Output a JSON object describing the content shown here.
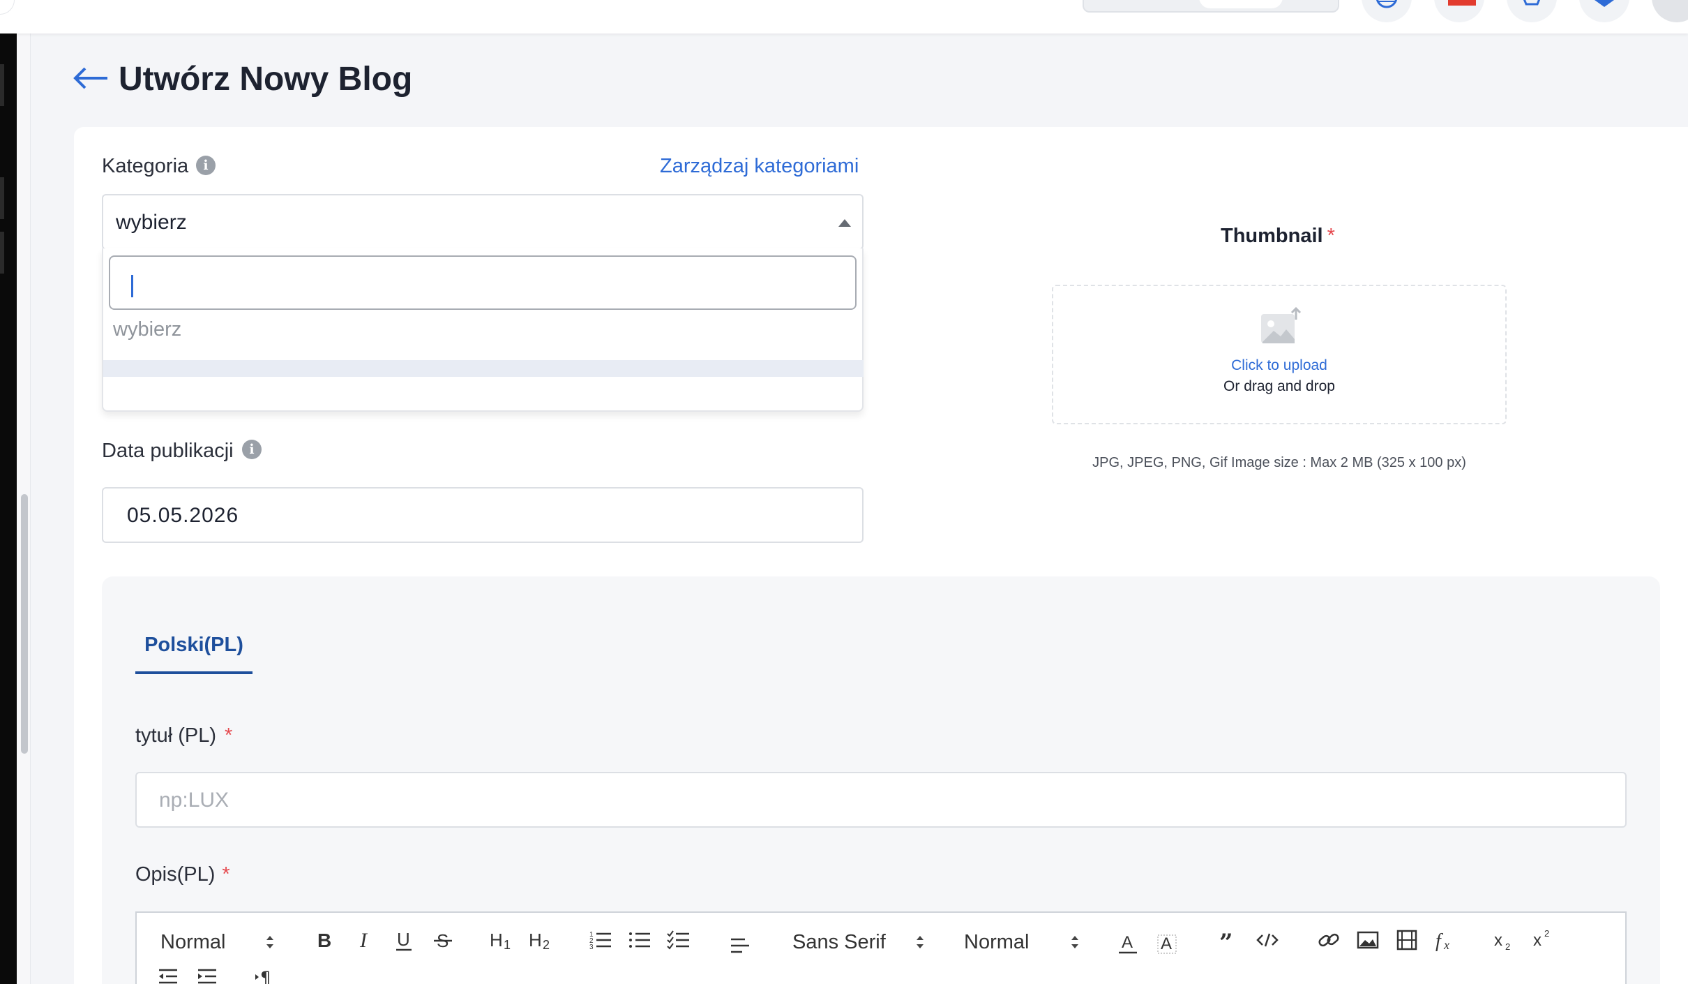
{
  "page": {
    "title": "Utwórz Nowy Blog"
  },
  "category": {
    "label": "Kategoria",
    "manage_link": "Zarządzaj kategoriami",
    "selected": "wybierz",
    "options": [
      "wybierz"
    ]
  },
  "publish_date": {
    "label": "Data publikacji",
    "value": "05.05.2026"
  },
  "thumbnail": {
    "title": "Thumbnail",
    "required_mark": "*",
    "upload_link": "Click to upload",
    "upload_sub": "Or drag and drop",
    "note": "JPG, JPEG, PNG, Gif Image size : Max 2 MB (325 x 100 px)"
  },
  "language_tabs": [
    {
      "label": "Polski(PL)",
      "active": true
    }
  ],
  "title_field": {
    "label": "tytuł (PL)",
    "required_mark": "*",
    "placeholder": "np:LUX"
  },
  "description_field": {
    "label": "Opis(PL)",
    "required_mark": "*"
  },
  "editor_toolbar": {
    "header_select": "Normal",
    "font_select": "Sans Serif",
    "size_select": "Normal",
    "icons": [
      "bold-icon",
      "italic-icon",
      "underline-icon",
      "strikethrough-icon",
      "h1-icon",
      "h2-icon",
      "ordered-list-icon",
      "bullet-list-icon",
      "check-list-icon",
      "align-icon",
      "text-color-icon",
      "background-color-icon",
      "blockquote-icon",
      "code-block-icon",
      "link-icon",
      "image-icon",
      "video-icon",
      "formula-icon",
      "subscript-icon",
      "superscript-icon",
      "outdent-icon",
      "indent-icon",
      "text-direction-icon"
    ]
  },
  "colors": {
    "accent": "#2e6bd6",
    "tab": "#1e4f9c",
    "required": "#e5484d"
  }
}
